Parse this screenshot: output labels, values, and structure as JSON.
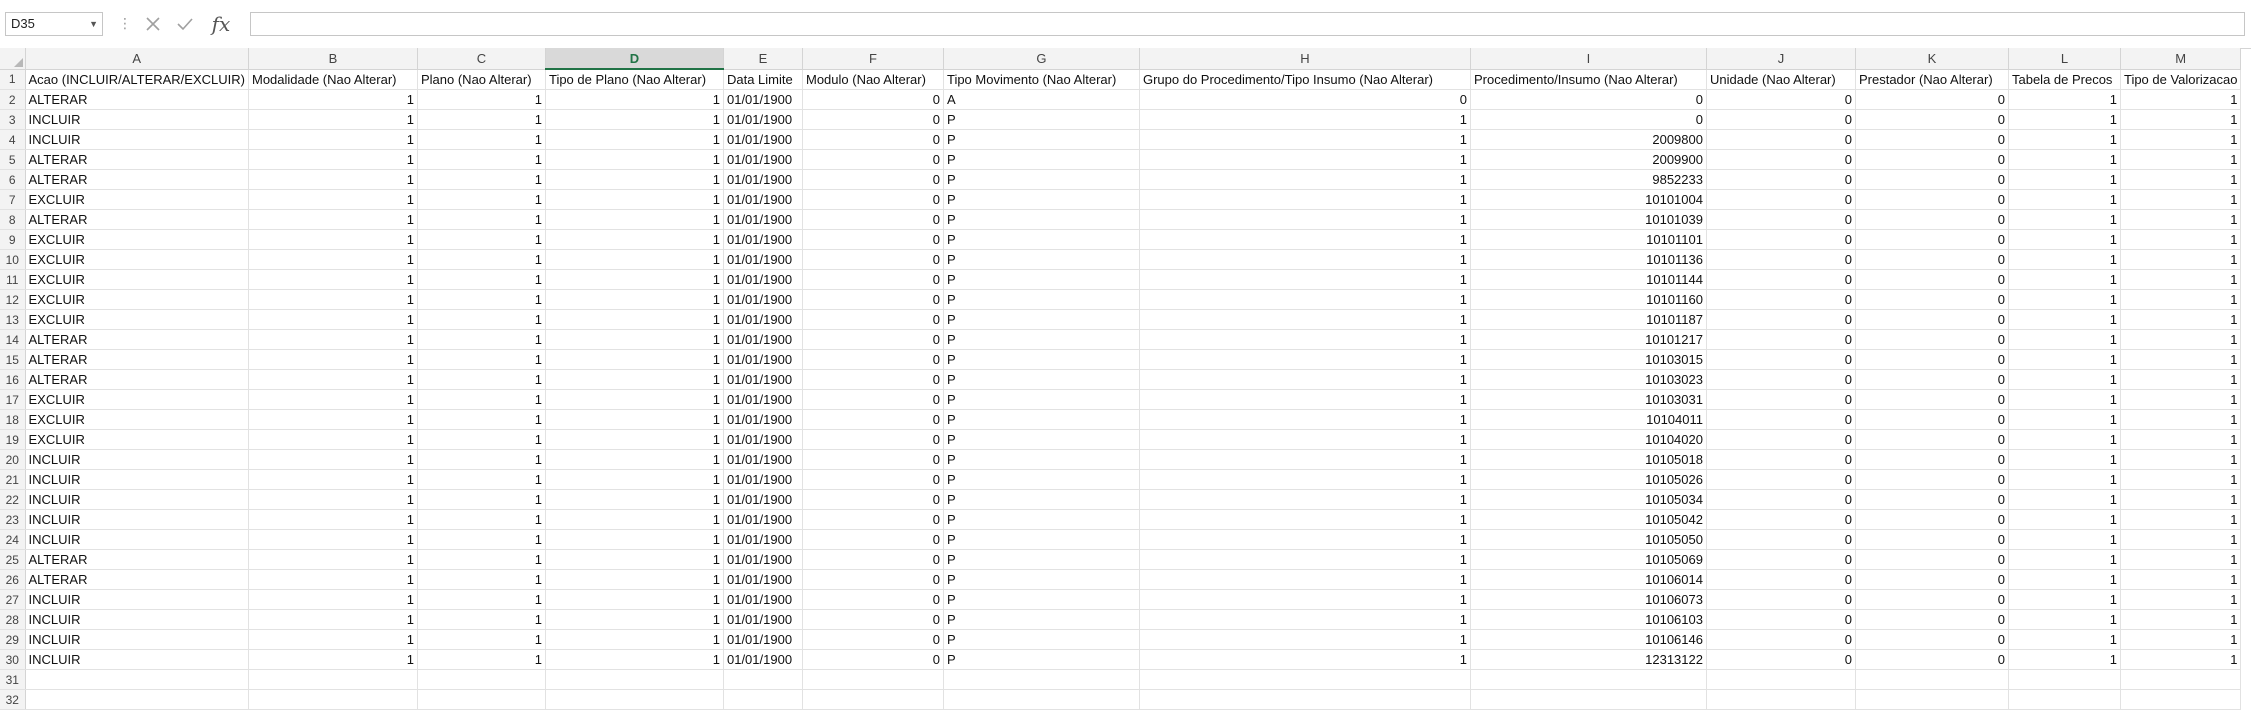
{
  "formula_bar": {
    "name_box": "D35",
    "formula": "",
    "cancel_icon": "close-icon",
    "enter_icon": "check-icon",
    "function_icon": "fx"
  },
  "selected_column": "D",
  "columns": [
    {
      "letter": "A",
      "header": "Acao (INCLUIR/ALTERAR/EXCLUIR)",
      "align": "txt"
    },
    {
      "letter": "B",
      "header": "Modalidade (Nao Alterar)",
      "align": "num"
    },
    {
      "letter": "C",
      "header": "Plano (Nao Alterar)",
      "align": "num"
    },
    {
      "letter": "D",
      "header": "Tipo de Plano (Nao Alterar)",
      "align": "num"
    },
    {
      "letter": "E",
      "header": "Data Limite",
      "align": "txt"
    },
    {
      "letter": "F",
      "header": "Modulo (Nao Alterar)",
      "align": "num"
    },
    {
      "letter": "G",
      "header": "Tipo Movimento (Nao Alterar)",
      "align": "txt"
    },
    {
      "letter": "H",
      "header": "Grupo do Procedimento/Tipo Insumo (Nao Alterar)",
      "align": "num"
    },
    {
      "letter": "I",
      "header": "Procedimento/Insumo (Nao Alterar)",
      "align": "num"
    },
    {
      "letter": "J",
      "header": "Unidade (Nao Alterar)",
      "align": "num"
    },
    {
      "letter": "K",
      "header": "Prestador (Nao Alterar)",
      "align": "num"
    },
    {
      "letter": "L",
      "header": "Tabela de Precos",
      "align": "num"
    },
    {
      "letter": "M",
      "header": "Tipo de Valorizacao",
      "align": "num"
    }
  ],
  "rows": [
    [
      "ALTERAR",
      "1",
      "1",
      "1",
      "01/01/1900",
      "0",
      "A",
      "0",
      "0",
      "0",
      "0",
      "1",
      "1"
    ],
    [
      "INCLUIR",
      "1",
      "1",
      "1",
      "01/01/1900",
      "0",
      "P",
      "1",
      "0",
      "0",
      "0",
      "1",
      "1"
    ],
    [
      "INCLUIR",
      "1",
      "1",
      "1",
      "01/01/1900",
      "0",
      "P",
      "1",
      "2009800",
      "0",
      "0",
      "1",
      "1"
    ],
    [
      "ALTERAR",
      "1",
      "1",
      "1",
      "01/01/1900",
      "0",
      "P",
      "1",
      "2009900",
      "0",
      "0",
      "1",
      "1"
    ],
    [
      "ALTERAR",
      "1",
      "1",
      "1",
      "01/01/1900",
      "0",
      "P",
      "1",
      "9852233",
      "0",
      "0",
      "1",
      "1"
    ],
    [
      "EXCLUIR",
      "1",
      "1",
      "1",
      "01/01/1900",
      "0",
      "P",
      "1",
      "10101004",
      "0",
      "0",
      "1",
      "1"
    ],
    [
      "ALTERAR",
      "1",
      "1",
      "1",
      "01/01/1900",
      "0",
      "P",
      "1",
      "10101039",
      "0",
      "0",
      "1",
      "1"
    ],
    [
      "EXCLUIR",
      "1",
      "1",
      "1",
      "01/01/1900",
      "0",
      "P",
      "1",
      "10101101",
      "0",
      "0",
      "1",
      "1"
    ],
    [
      "EXCLUIR",
      "1",
      "1",
      "1",
      "01/01/1900",
      "0",
      "P",
      "1",
      "10101136",
      "0",
      "0",
      "1",
      "1"
    ],
    [
      "EXCLUIR",
      "1",
      "1",
      "1",
      "01/01/1900",
      "0",
      "P",
      "1",
      "10101144",
      "0",
      "0",
      "1",
      "1"
    ],
    [
      "EXCLUIR",
      "1",
      "1",
      "1",
      "01/01/1900",
      "0",
      "P",
      "1",
      "10101160",
      "0",
      "0",
      "1",
      "1"
    ],
    [
      "EXCLUIR",
      "1",
      "1",
      "1",
      "01/01/1900",
      "0",
      "P",
      "1",
      "10101187",
      "0",
      "0",
      "1",
      "1"
    ],
    [
      "ALTERAR",
      "1",
      "1",
      "1",
      "01/01/1900",
      "0",
      "P",
      "1",
      "10101217",
      "0",
      "0",
      "1",
      "1"
    ],
    [
      "ALTERAR",
      "1",
      "1",
      "1",
      "01/01/1900",
      "0",
      "P",
      "1",
      "10103015",
      "0",
      "0",
      "1",
      "1"
    ],
    [
      "ALTERAR",
      "1",
      "1",
      "1",
      "01/01/1900",
      "0",
      "P",
      "1",
      "10103023",
      "0",
      "0",
      "1",
      "1"
    ],
    [
      "EXCLUIR",
      "1",
      "1",
      "1",
      "01/01/1900",
      "0",
      "P",
      "1",
      "10103031",
      "0",
      "0",
      "1",
      "1"
    ],
    [
      "EXCLUIR",
      "1",
      "1",
      "1",
      "01/01/1900",
      "0",
      "P",
      "1",
      "10104011",
      "0",
      "0",
      "1",
      "1"
    ],
    [
      "EXCLUIR",
      "1",
      "1",
      "1",
      "01/01/1900",
      "0",
      "P",
      "1",
      "10104020",
      "0",
      "0",
      "1",
      "1"
    ],
    [
      "INCLUIR",
      "1",
      "1",
      "1",
      "01/01/1900",
      "0",
      "P",
      "1",
      "10105018",
      "0",
      "0",
      "1",
      "1"
    ],
    [
      "INCLUIR",
      "1",
      "1",
      "1",
      "01/01/1900",
      "0",
      "P",
      "1",
      "10105026",
      "0",
      "0",
      "1",
      "1"
    ],
    [
      "INCLUIR",
      "1",
      "1",
      "1",
      "01/01/1900",
      "0",
      "P",
      "1",
      "10105034",
      "0",
      "0",
      "1",
      "1"
    ],
    [
      "INCLUIR",
      "1",
      "1",
      "1",
      "01/01/1900",
      "0",
      "P",
      "1",
      "10105042",
      "0",
      "0",
      "1",
      "1"
    ],
    [
      "INCLUIR",
      "1",
      "1",
      "1",
      "01/01/1900",
      "0",
      "P",
      "1",
      "10105050",
      "0",
      "0",
      "1",
      "1"
    ],
    [
      "ALTERAR",
      "1",
      "1",
      "1",
      "01/01/1900",
      "0",
      "P",
      "1",
      "10105069",
      "0",
      "0",
      "1",
      "1"
    ],
    [
      "ALTERAR",
      "1",
      "1",
      "1",
      "01/01/1900",
      "0",
      "P",
      "1",
      "10106014",
      "0",
      "0",
      "1",
      "1"
    ],
    [
      "INCLUIR",
      "1",
      "1",
      "1",
      "01/01/1900",
      "0",
      "P",
      "1",
      "10106073",
      "0",
      "0",
      "1",
      "1"
    ],
    [
      "INCLUIR",
      "1",
      "1",
      "1",
      "01/01/1900",
      "0",
      "P",
      "1",
      "10106103",
      "0",
      "0",
      "1",
      "1"
    ],
    [
      "INCLUIR",
      "1",
      "1",
      "1",
      "01/01/1900",
      "0",
      "P",
      "1",
      "10106146",
      "0",
      "0",
      "1",
      "1"
    ],
    [
      "INCLUIR",
      "1",
      "1",
      "1",
      "01/01/1900",
      "0",
      "P",
      "1",
      "12313122",
      "0",
      "0",
      "1",
      "1"
    ],
    [
      "",
      "",
      "",
      "",
      "",
      "",
      "",
      "",
      "",
      "",
      "",
      "",
      ""
    ],
    [
      "",
      "",
      "",
      "",
      "",
      "",
      "",
      "",
      "",
      "",
      "",
      "",
      ""
    ]
  ]
}
